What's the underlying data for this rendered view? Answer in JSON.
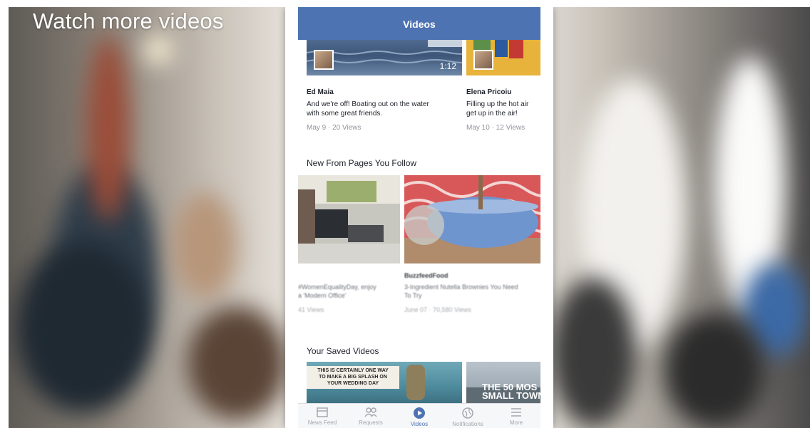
{
  "headline": "Watch more videos",
  "app": {
    "title": "Videos"
  },
  "recent_videos": [
    {
      "author": "Ed Maia",
      "desc1": "And we're off! Boating out on the water",
      "desc2": "with some great friends.",
      "meta": "May 9 · 20 Views",
      "duration": "1:12"
    },
    {
      "author": "Elena Pricoiu",
      "desc1": "Filling up the hot air",
      "desc2": "get up in the air!",
      "meta": "May 10 · 12 Views"
    }
  ],
  "pages_section": {
    "title": "New From Pages You Follow"
  },
  "page_videos": [
    {
      "page": "",
      "desc1": "#WomenEqualityDay, enjoy",
      "desc2": "a 'Modern Office'",
      "meta": "41 Views"
    },
    {
      "page": "BuzzfeedFood",
      "desc1": "3-Ingredient Nutella Brownies You Need",
      "desc2": "To Try",
      "meta": "June 07 · 70,580 Views"
    }
  ],
  "saved_section": {
    "title": "Your Saved Videos"
  },
  "saved_videos": [
    {
      "line1": "THIS IS CERTAINLY ONE WAY",
      "line2": "TO MAKE A BIG SPLASH ON",
      "line3": "YOUR WEDDING DAY"
    },
    {
      "line1": "THE 50 MOS",
      "line2": "SMALL TOWN"
    }
  ],
  "tabbar": [
    {
      "label": "News Feed",
      "icon": "news-feed-icon"
    },
    {
      "label": "Requests",
      "icon": "requests-icon"
    },
    {
      "label": "Videos",
      "icon": "videos-icon",
      "active": true
    },
    {
      "label": "Notifications",
      "icon": "globe-icon"
    },
    {
      "label": "More",
      "icon": "menu-icon"
    }
  ],
  "colors": {
    "brand_blue": "#4d73b2",
    "text": "#1d2129",
    "muted": "#90949c"
  }
}
